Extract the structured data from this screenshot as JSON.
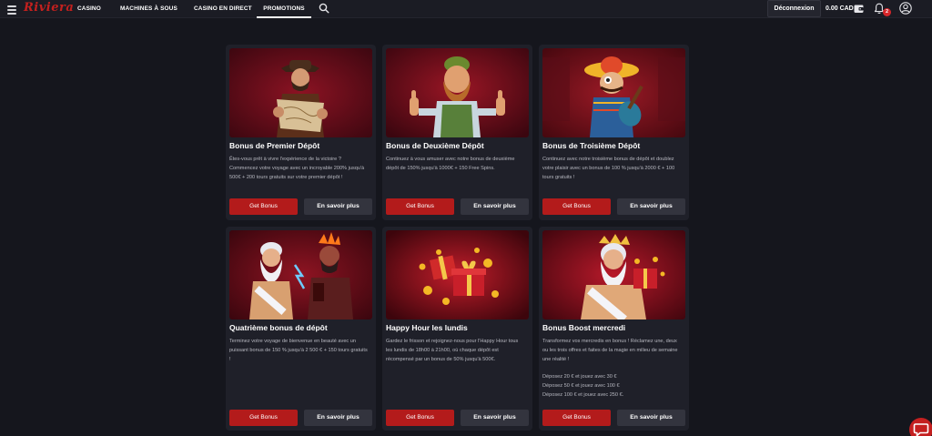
{
  "header": {
    "logo": "Riviera",
    "nav": [
      "CASINO",
      "MACHINES À SOUS",
      "CASINO EN DIRECT",
      "PROMOTIONS"
    ],
    "active_nav": "PROMOTIONS",
    "logout_label": "Déconnexion",
    "balance": "0.00 CAD",
    "notifications_count": "2"
  },
  "colors": {
    "background": "#15161d",
    "card": "#1f2029",
    "primary_button": "#b31b1b",
    "secondary_button": "#33343e",
    "brand": "#c4201e"
  },
  "promotions": [
    {
      "title": "Bonus de Premier Dépôt",
      "description": [
        "Êtes-vous prêt à vivre l'expérience de la victoire ? Commencez votre voyage avec un incroyable 200% jusqu'à 500€ + 200 tours gratuits sur votre premier dépôt !"
      ],
      "get_label": "Get Bonus",
      "more_label": "En savoir plus",
      "image_icon": "cowboy-with-map"
    },
    {
      "title": "Bonus de Deuxième Dépôt",
      "description": [
        "Continuez à vous amuser avec notre bonus de deuxième dépôt de 150% jusqu'à 1000€ + 150 Free Spins."
      ],
      "get_label": "Get Bonus",
      "more_label": "En savoir plus",
      "image_icon": "bearded-man-thumbs-up"
    },
    {
      "title": "Bonus de Troisième Dépôt",
      "description": [
        "Continuez avec notre troisième bonus de dépôt et doublez votre plaisir avec un bonus de 100 % jusqu'à 2000 € + 100 tours gratuits !"
      ],
      "get_label": "Get Bonus",
      "more_label": "En savoir plus",
      "image_icon": "mariachi-guitar"
    },
    {
      "title": "Quatrième bonus de dépôt",
      "description": [
        "Terminez votre voyage de bienvenue en beauté avec un puissant bonus de 150 % jusqu'à 2 500 € + 150 tours gratuits !"
      ],
      "get_label": "Get Bonus",
      "more_label": "En savoir plus",
      "image_icon": "zeus-and-hades"
    },
    {
      "title": "Happy Hour les lundis",
      "description": [
        "Gardez le frisson et rejoignez-nous pour l'Happy Hour tous les lundis de 18h00 à 21h00, où chaque dépôt est récompensé par un bonus de 50% jusqu'à 500€."
      ],
      "get_label": "Get Bonus",
      "more_label": "En savoir plus",
      "image_icon": "gift-boxes-coins"
    },
    {
      "title": "Bonus Boost mercredi",
      "description": [
        "Transformez vos mercredis en bonus ! Réclamez une, deux ou les trois offres et faites de la magie en milieu de semaine une réalité !",
        "",
        "Déposez 20 € et jouez avec 30 €",
        "Déposez 50 € et jouez avec 100 €",
        "Déposez 100 € et jouez avec 250 €."
      ],
      "get_label": "Get Bonus",
      "more_label": "En savoir plus",
      "image_icon": "zeus-gift-box"
    }
  ]
}
